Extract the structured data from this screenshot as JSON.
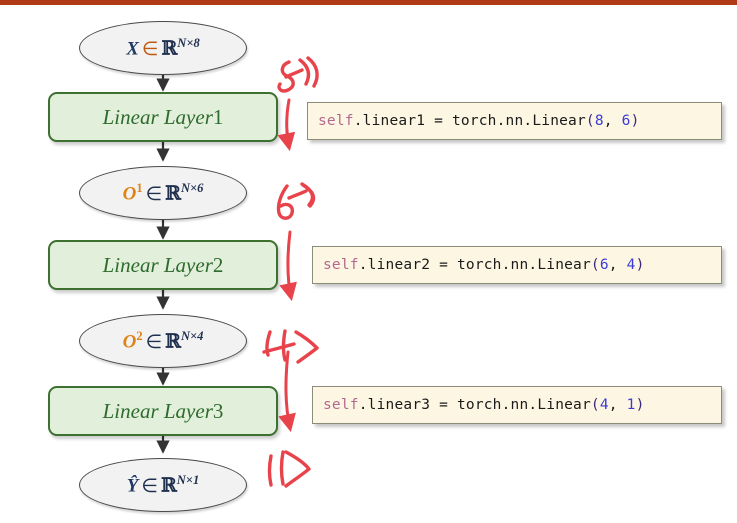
{
  "page": {
    "title": "Linear layer stack diagram with PyTorch code annotations",
    "background_color": "#ffffff",
    "top_bar_color": "#b03a16"
  },
  "theme": {
    "ellipse_fill": "#f2f2f2",
    "ellipse_stroke": "#4a4a4a",
    "layer_fill": "#e2efda",
    "layer_stroke": "#3e7030",
    "layer_text": "#2e6b2e",
    "code_fill": "#fdf6e3",
    "code_stroke": "#8c8c7a",
    "code_self_color": "#b5688f",
    "code_number_color": "#3a3ad6",
    "code_paren_color": "#3b2a7a",
    "annotation_color": "#e8434a",
    "arrow_color": "#333333",
    "var_color": "#1f3864",
    "var_o_color": "#e08214",
    "elem_color": "#c05a10"
  },
  "nodes": [
    {
      "id": "input",
      "kind": "ellipse",
      "var": "X",
      "var_sup": "",
      "elem": "∈",
      "set": "ℝ",
      "set_sup": "N×8",
      "full_text": "X ∈ ℝ^{N×8}",
      "rows": "N",
      "cols": "8"
    },
    {
      "id": "o1",
      "kind": "ellipse",
      "var": "O",
      "var_sup": "1",
      "elem": "∈",
      "set": "ℝ",
      "set_sup": "N×6",
      "full_text": "O¹ ∈ ℝ^{N×6}",
      "rows": "N",
      "cols": "6"
    },
    {
      "id": "o2",
      "kind": "ellipse",
      "var": "O",
      "var_sup": "2",
      "elem": "∈",
      "set": "ℝ",
      "set_sup": "N×4",
      "full_text": "O² ∈ ℝ^{N×4}",
      "rows": "N",
      "cols": "4"
    },
    {
      "id": "yhat",
      "kind": "ellipse",
      "var": "Ŷ",
      "var_sup": "",
      "elem": "∈",
      "set": "ℝ",
      "set_sup": "N×1",
      "full_text": "Ŷ ∈ ℝ^{N×1}",
      "rows": "N",
      "cols": "1"
    }
  ],
  "layers": [
    {
      "id": "layer1",
      "name": "Linear Layer",
      "number": "1"
    },
    {
      "id": "layer2",
      "name": "Linear Layer",
      "number": "2"
    },
    {
      "id": "layer3",
      "name": "Linear Layer",
      "number": "3"
    }
  ],
  "code_boxes": [
    {
      "id": "code1",
      "self": "self",
      "body": ".linear1 = torch.nn.Linear",
      "open_paren": "(",
      "in_features": "8",
      "comma": ", ",
      "out_features": "6",
      "close_paren": ")",
      "full_text": "self.linear1 = torch.nn.Linear(8, 6)"
    },
    {
      "id": "code2",
      "self": "self",
      "body": ".linear2 = torch.nn.Linear",
      "open_paren": "(",
      "in_features": "6",
      "comma": ", ",
      "out_features": "4",
      "close_paren": ")",
      "full_text": "self.linear2 = torch.nn.Linear(6, 4)"
    },
    {
      "id": "code3",
      "self": "self",
      "body": ".linear3 = torch.nn.Linear",
      "open_paren": "(",
      "in_features": "4",
      "comma": ", ",
      "out_features": "1",
      "close_paren": ")",
      "full_text": "self.linear3 = torch.nn.Linear(4, 1)"
    }
  ],
  "annotations": [
    {
      "id": "ann8",
      "text": "8)",
      "digit": "8"
    },
    {
      "id": "ann6",
      "text": "6)",
      "digit": "6"
    },
    {
      "id": "ann4",
      "text": "4)",
      "digit": "4"
    },
    {
      "id": "ann1",
      "text": "1)",
      "digit": "1"
    }
  ]
}
